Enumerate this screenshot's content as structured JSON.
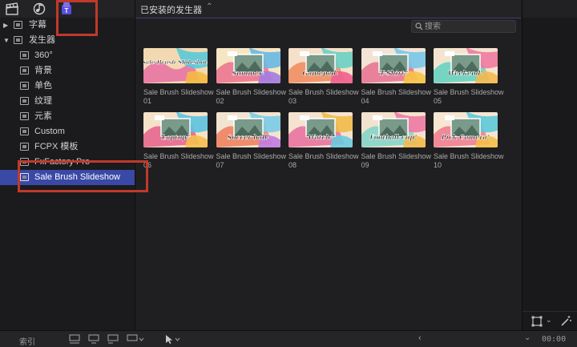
{
  "sidebar": {
    "toolbar_icons": [
      "clapper-icon",
      "music-icon",
      "titles-icon"
    ],
    "tree": [
      {
        "label": "字幕",
        "level": "top",
        "disclosure": "▶"
      },
      {
        "label": "发生器",
        "level": "top",
        "disclosure": "▼"
      },
      {
        "label": "360°",
        "level": "child"
      },
      {
        "label": "背景",
        "level": "child"
      },
      {
        "label": "单色",
        "level": "child"
      },
      {
        "label": "纹理",
        "level": "child"
      },
      {
        "label": "元素",
        "level": "child"
      },
      {
        "label": "Custom",
        "level": "child"
      },
      {
        "label": "FCPX 模板",
        "level": "child"
      },
      {
        "label": "FxFactory Pro",
        "level": "child"
      },
      {
        "label": "Sale Brush Slideshow",
        "level": "child",
        "selected": true
      }
    ]
  },
  "main": {
    "header_title": "已安装的发生器",
    "header_chevron": "⌃",
    "search": {
      "placeholder": "搜索",
      "value": ""
    },
    "tiles": [
      {
        "name": "Sale Brush Slideshow 01",
        "thumb_text": "Sale Brush Slideshow"
      },
      {
        "name": "Sale Brush Slideshow 02",
        "thumb_text": "Summer!"
      },
      {
        "name": "Sale Brush Slideshow 03",
        "thumb_text": "Gamepad!"
      },
      {
        "name": "Sale Brush Slideshow 04",
        "thumb_text": "T-Shirt!"
      },
      {
        "name": "Sale Brush Slideshow 05",
        "thumb_text": "Weekend!"
      },
      {
        "name": "Sale Brush Slideshow 06",
        "thumb_text": "Laptop!"
      },
      {
        "name": "Sale Brush Slideshow 07",
        "thumb_text": "Soccer ball!"
      },
      {
        "name": "Sale Brush Slideshow 08",
        "thumb_text": "Watch!"
      },
      {
        "name": "Sale Brush Slideshow 09",
        "thumb_text": "Football cup!"
      },
      {
        "name": "Sale Brush Slideshow 10",
        "thumb_text": "Pick Camera!"
      }
    ]
  },
  "bottom": {
    "index_label": "索引",
    "timecode": "00:00"
  },
  "colors": {
    "selection": "#3a48a6",
    "accent_purple": "#5b4de0",
    "annotation_red": "#c0392b"
  }
}
